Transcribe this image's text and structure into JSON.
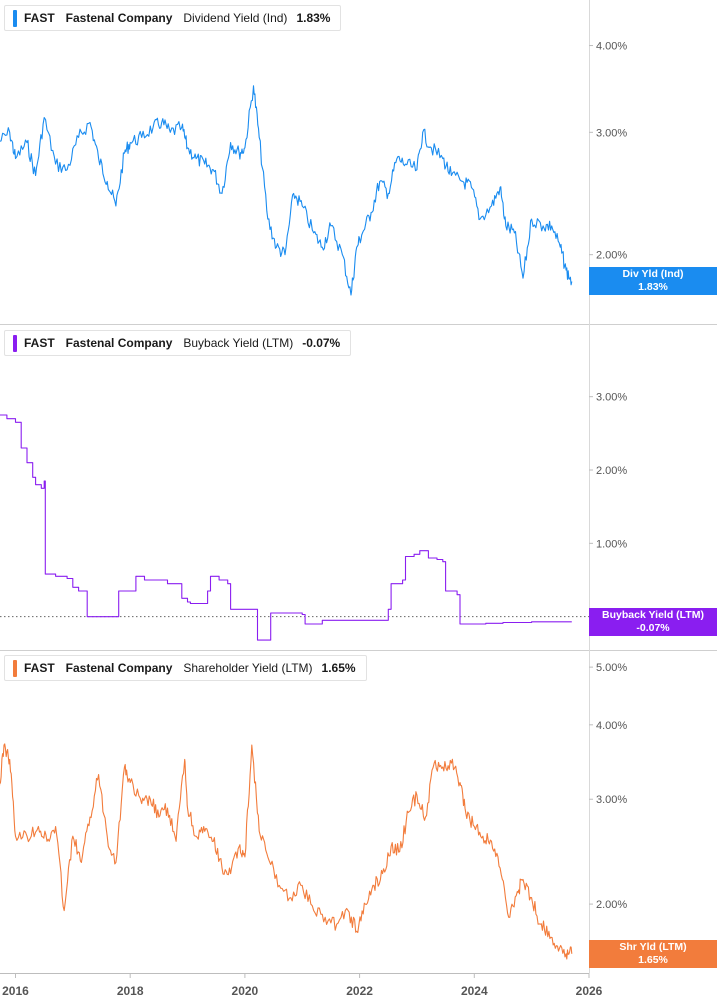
{
  "legend_colors": [
    "#1a8cf0",
    "#8a1ef0",
    "#f27c3c"
  ],
  "chart_data": [
    {
      "type": "line",
      "ticker": "FAST",
      "company": "Fastenal Company",
      "metric": "Dividend Yield (Ind)",
      "value_label": "1.83%",
      "badge_name": "Div Yld (Ind)",
      "badge_value": "1.83%",
      "color": "#1a8cf0",
      "scale": "log",
      "ylim": [
        1.6,
        4.5
      ],
      "yticks": [
        {
          "v": 4.0,
          "label": "4.00%"
        },
        {
          "v": 3.0,
          "label": "3.00%"
        },
        {
          "v": 2.0,
          "label": "2.00%"
        }
      ],
      "x": [
        2015.7,
        2015.9,
        2016.0,
        2016.2,
        2016.35,
        2016.5,
        2016.7,
        2016.9,
        2017.1,
        2017.3,
        2017.45,
        2017.6,
        2017.75,
        2017.9,
        2018.0,
        2018.2,
        2018.4,
        2018.55,
        2018.7,
        2018.9,
        2019.0,
        2019.15,
        2019.3,
        2019.45,
        2019.6,
        2019.75,
        2019.9,
        2020.0,
        2020.15,
        2020.25,
        2020.4,
        2020.55,
        2020.7,
        2020.85,
        2021.0,
        2021.2,
        2021.35,
        2021.5,
        2021.7,
        2021.85,
        2021.95,
        2022.05,
        2022.2,
        2022.35,
        2022.5,
        2022.65,
        2022.8,
        2023.0,
        2023.1,
        2023.25,
        2023.45,
        2023.6,
        2023.8,
        2023.95,
        2024.1,
        2024.3,
        2024.45,
        2024.55,
        2024.7,
        2024.85,
        2025.0,
        2025.2,
        2025.35,
        2025.5,
        2025.6,
        2025.7
      ],
      "y": [
        2.9,
        3.0,
        2.75,
        2.9,
        2.6,
        3.15,
        2.7,
        2.65,
        2.95,
        3.1,
        2.75,
        2.55,
        2.35,
        2.8,
        2.9,
        2.95,
        3.05,
        3.1,
        3.0,
        3.05,
        2.85,
        2.75,
        2.7,
        2.65,
        2.45,
        2.9,
        2.8,
        2.85,
        3.5,
        2.95,
        2.25,
        2.05,
        2.0,
        2.45,
        2.35,
        2.15,
        2.05,
        2.2,
        2.0,
        1.75,
        2.05,
        2.15,
        2.3,
        2.55,
        2.45,
        2.75,
        2.7,
        2.65,
        3.0,
        2.85,
        2.75,
        2.6,
        2.55,
        2.5,
        2.25,
        2.35,
        2.5,
        2.2,
        2.15,
        1.85,
        2.25,
        2.2,
        2.2,
        2.05,
        1.9,
        1.83
      ]
    },
    {
      "type": "line",
      "ticker": "FAST",
      "company": "Fastenal Company",
      "metric": "Buyback Yield (LTM)",
      "value_label": "-0.07%",
      "badge_name": "Buyback Yield (LTM)",
      "badge_value": "-0.07%",
      "color": "#8a1ef0",
      "scale": "linear",
      "ylim": [
        -0.4,
        3.8
      ],
      "zero_line": true,
      "yticks": [
        {
          "v": 3.0,
          "label": "3.00%"
        },
        {
          "v": 2.0,
          "label": "2.00%"
        },
        {
          "v": 1.0,
          "label": "1.00%"
        }
      ],
      "x": [
        2015.7,
        2015.85,
        2016.0,
        2016.1,
        2016.2,
        2016.3,
        2016.35,
        2016.45,
        2016.5,
        2016.52,
        2016.7,
        2016.9,
        2017.0,
        2017.1,
        2017.2,
        2017.25,
        2017.4,
        2017.5,
        2017.6,
        2017.8,
        2018.0,
        2018.1,
        2018.2,
        2018.25,
        2018.5,
        2018.65,
        2018.8,
        2018.9,
        2019.0,
        2019.05,
        2019.3,
        2019.35,
        2019.4,
        2019.55,
        2019.7,
        2019.75,
        2019.9,
        2020.0,
        2020.1,
        2020.2,
        2020.22,
        2020.45,
        2020.6,
        2020.8,
        2021.0,
        2021.05,
        2021.3,
        2021.35,
        2021.55,
        2021.8,
        2022.0,
        2022.35,
        2022.5,
        2022.55,
        2022.75,
        2022.8,
        2022.95,
        2023.0,
        2023.05,
        2023.2,
        2023.35,
        2023.45,
        2023.5,
        2023.7,
        2023.75,
        2023.95,
        2024.0,
        2024.2,
        2024.5,
        2024.8,
        2025.0,
        2025.3,
        2025.7
      ],
      "y": [
        2.75,
        2.7,
        2.65,
        2.3,
        2.1,
        1.9,
        1.8,
        1.75,
        1.85,
        0.58,
        0.55,
        0.52,
        0.4,
        0.35,
        0.35,
        0.0,
        0.0,
        0.0,
        0.0,
        0.35,
        0.35,
        0.55,
        0.55,
        0.5,
        0.5,
        0.45,
        0.45,
        0.25,
        0.2,
        0.18,
        0.18,
        0.35,
        0.55,
        0.5,
        0.45,
        0.1,
        0.1,
        0.1,
        0.1,
        0.1,
        -0.32,
        0.05,
        0.05,
        0.05,
        0.03,
        -0.1,
        -0.1,
        -0.05,
        -0.05,
        -0.05,
        -0.05,
        -0.05,
        0.1,
        0.45,
        0.5,
        0.82,
        0.85,
        0.85,
        0.9,
        0.8,
        0.78,
        0.75,
        0.35,
        0.3,
        -0.1,
        -0.1,
        -0.1,
        -0.09,
        -0.08,
        -0.08,
        -0.07,
        -0.07,
        -0.07
      ]
    },
    {
      "type": "line",
      "ticker": "FAST",
      "company": "Fastenal Company",
      "metric": "Shareholder Yield (LTM)",
      "value_label": "1.65%",
      "badge_name": "Shr Yld (LTM)",
      "badge_value": "1.65%",
      "color": "#f27c3c",
      "scale": "log",
      "ylim": [
        1.55,
        5.1
      ],
      "yticks": [
        {
          "v": 5.0,
          "label": "5.00%"
        },
        {
          "v": 4.0,
          "label": "4.00%"
        },
        {
          "v": 3.0,
          "label": "3.00%"
        },
        {
          "v": 2.0,
          "label": "2.00%"
        }
      ],
      "x": [
        2015.7,
        2015.8,
        2015.9,
        2016.0,
        2016.2,
        2016.4,
        2016.55,
        2016.7,
        2016.85,
        2017.0,
        2017.15,
        2017.3,
        2017.45,
        2017.6,
        2017.75,
        2017.9,
        2018.0,
        2018.2,
        2018.35,
        2018.5,
        2018.65,
        2018.8,
        2018.95,
        2019.0,
        2019.15,
        2019.3,
        2019.45,
        2019.6,
        2019.75,
        2019.9,
        2020.0,
        2020.12,
        2020.25,
        2020.4,
        2020.6,
        2020.8,
        2021.0,
        2021.2,
        2021.4,
        2021.6,
        2021.8,
        2021.95,
        2022.1,
        2022.25,
        2022.4,
        2022.55,
        2022.7,
        2022.85,
        2023.0,
        2023.15,
        2023.3,
        2023.45,
        2023.6,
        2023.75,
        2023.85,
        2024.0,
        2024.15,
        2024.3,
        2024.45,
        2024.6,
        2024.75,
        2024.85,
        2025.0,
        2025.15,
        2025.3,
        2025.45,
        2025.6,
        2025.7
      ],
      "y": [
        3.0,
        3.7,
        3.5,
        2.6,
        2.6,
        2.7,
        2.55,
        2.7,
        1.95,
        2.6,
        2.35,
        2.8,
        3.3,
        2.6,
        2.35,
        3.4,
        3.2,
        2.95,
        3.0,
        2.8,
        2.9,
        2.55,
        3.5,
        2.9,
        2.6,
        2.65,
        2.55,
        2.3,
        2.25,
        2.5,
        2.4,
        3.7,
        2.65,
        2.4,
        2.15,
        2.05,
        2.15,
        1.95,
        1.9,
        1.85,
        1.95,
        1.8,
        2.0,
        2.15,
        2.25,
        2.5,
        2.45,
        2.85,
        3.05,
        2.8,
        3.45,
        3.4,
        3.45,
        3.2,
        2.85,
        2.7,
        2.6,
        2.55,
        2.3,
        1.9,
        2.1,
        2.2,
        2.05,
        1.85,
        1.8,
        1.7,
        1.65,
        1.65
      ]
    }
  ],
  "x_axis": {
    "ticks": [
      {
        "v": 2016,
        "label": "2016"
      },
      {
        "v": 2018,
        "label": "2018"
      },
      {
        "v": 2020,
        "label": "2020"
      },
      {
        "v": 2022,
        "label": "2022"
      },
      {
        "v": 2024,
        "label": "2024"
      },
      {
        "v": 2026,
        "label": "2026"
      }
    ]
  }
}
